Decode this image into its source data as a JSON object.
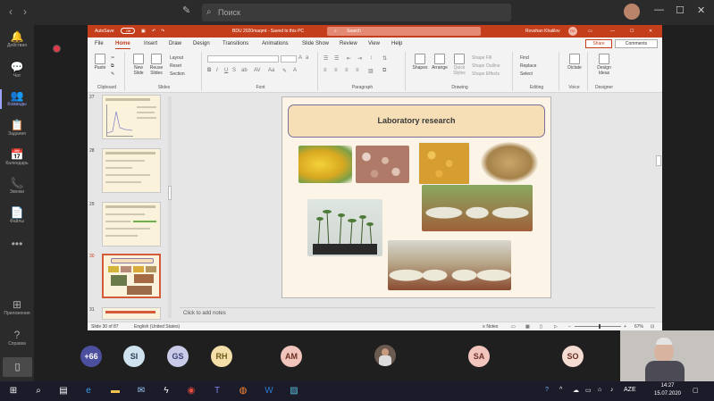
{
  "teams": {
    "search_placeholder": "Поиск",
    "rail": [
      {
        "icon": "bell-icon",
        "glyph": "🔔",
        "label": "Действия"
      },
      {
        "icon": "chat-icon",
        "glyph": "💬",
        "label": "Чат"
      },
      {
        "icon": "teams-icon",
        "glyph": "👥",
        "label": "Команды"
      },
      {
        "icon": "assignments-icon",
        "glyph": "📋",
        "label": "Задания"
      },
      {
        "icon": "calendar-icon",
        "glyph": "📅",
        "label": "Календарь"
      },
      {
        "icon": "calls-icon",
        "glyph": "📞",
        "label": "Звонки"
      },
      {
        "icon": "files-icon",
        "glyph": "📄",
        "label": "Файлы"
      },
      {
        "icon": "more-icon",
        "glyph": "•••",
        "label": ""
      },
      {
        "icon": "apps-icon",
        "glyph": "⊞",
        "label": "Приложения"
      },
      {
        "icon": "help-icon",
        "glyph": "?",
        "label": "Справка"
      }
    ]
  },
  "ppt": {
    "autosave_label": "AutoSave",
    "autosave_state": "Off",
    "doc_title": "BDU 2020maqmt  -  Saved to this PC",
    "search_placeholder": "Search",
    "user_name": "Rovshan Khalilov",
    "user_initials": "RK",
    "tabs": [
      "File",
      "Home",
      "Insert",
      "Draw",
      "Design",
      "Transitions",
      "Animations",
      "Slide Show",
      "Review",
      "View",
      "Help"
    ],
    "share_label": "Share",
    "comments_label": "Comments",
    "ribbon": {
      "clipboard": "Clipboard",
      "paste": "Paste",
      "slides": "Slides",
      "new_slide": "New Slide",
      "reuse_slides": "Reuse Slides",
      "layout": "Layout",
      "reset": "Reset",
      "section": "Section",
      "font": "Font",
      "paragraph": "Paragraph",
      "drawing": "Drawing",
      "shapes": "Shapes",
      "arrange": "Arrange",
      "quick_styles": "Quick Styles",
      "shape_fill": "Shape Fill",
      "shape_outline": "Shape Outline",
      "shape_effects": "Shape Effects",
      "editing": "Editing",
      "find": "Find",
      "replace": "Replace",
      "select": "Select",
      "voice": "Voice",
      "dictate": "Dictate",
      "designer": "Designer",
      "design_ideas": "Design Ideas"
    },
    "thumbnails": [
      {
        "num": "27"
      },
      {
        "num": "28"
      },
      {
        "num": "29"
      },
      {
        "num": "30"
      },
      {
        "num": "31"
      }
    ],
    "slide": {
      "title": "Laboratory research"
    },
    "notes_placeholder": "Click to add notes",
    "status": {
      "slide_info": "Slide 30 of 87",
      "language": "English (United States)",
      "notes": "Notes",
      "zoom": "67%"
    }
  },
  "participants": [
    {
      "initials": "+66",
      "bg": "#4b4f9e",
      "fg": "#ffffff"
    },
    {
      "initials": "SI",
      "bg": "#cfe3ef",
      "fg": "#2d3e55"
    },
    {
      "initials": "GS",
      "bg": "#c9cbe8",
      "fg": "#3a3f74"
    },
    {
      "initials": "RH",
      "bg": "#f4dfa8",
      "fg": "#6d5a1b"
    },
    {
      "initials": "AM",
      "bg": "#f2c5bc",
      "fg": "#6a2e22"
    },
    {
      "initials": "SA",
      "bg": "#f2c5bc",
      "fg": "#6a2e22"
    },
    {
      "initials": "SO",
      "bg": "#f4dcd3",
      "fg": "#6a2e22"
    }
  ],
  "taskbar": {
    "language": "AZE",
    "time": "14:27",
    "date": "15.07.2020"
  },
  "colors": {
    "ppt_accent": "#c43e1c",
    "teams_accent": "#9ea2ff",
    "slide_bg": "#fbf4e7"
  }
}
